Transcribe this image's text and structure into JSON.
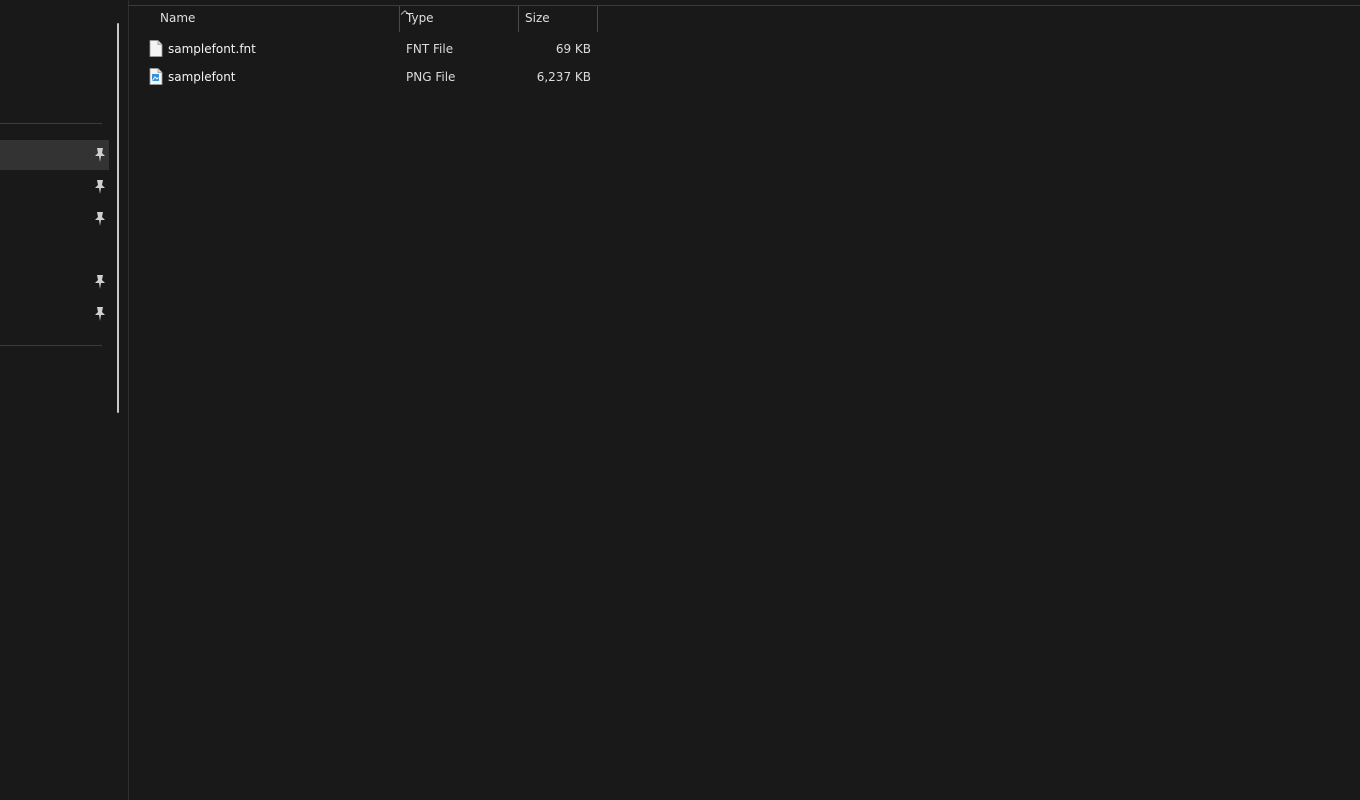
{
  "columns": {
    "name": "Name",
    "type": "Type",
    "size": "Size",
    "sort": "ascending"
  },
  "files": [
    {
      "name": "samplefont.fnt",
      "type": "FNT File",
      "size": "69 KB",
      "icon": "generic-file-icon"
    },
    {
      "name": "samplefont",
      "type": "PNG File",
      "size": "6,237 KB",
      "icon": "image-file-icon"
    }
  ],
  "navigation": {
    "selected_index": 0,
    "pinned_count": 5
  },
  "colors": {
    "background": "#191919",
    "selected_nav": "#333333",
    "image_icon_accent": "#3a8fd6"
  }
}
